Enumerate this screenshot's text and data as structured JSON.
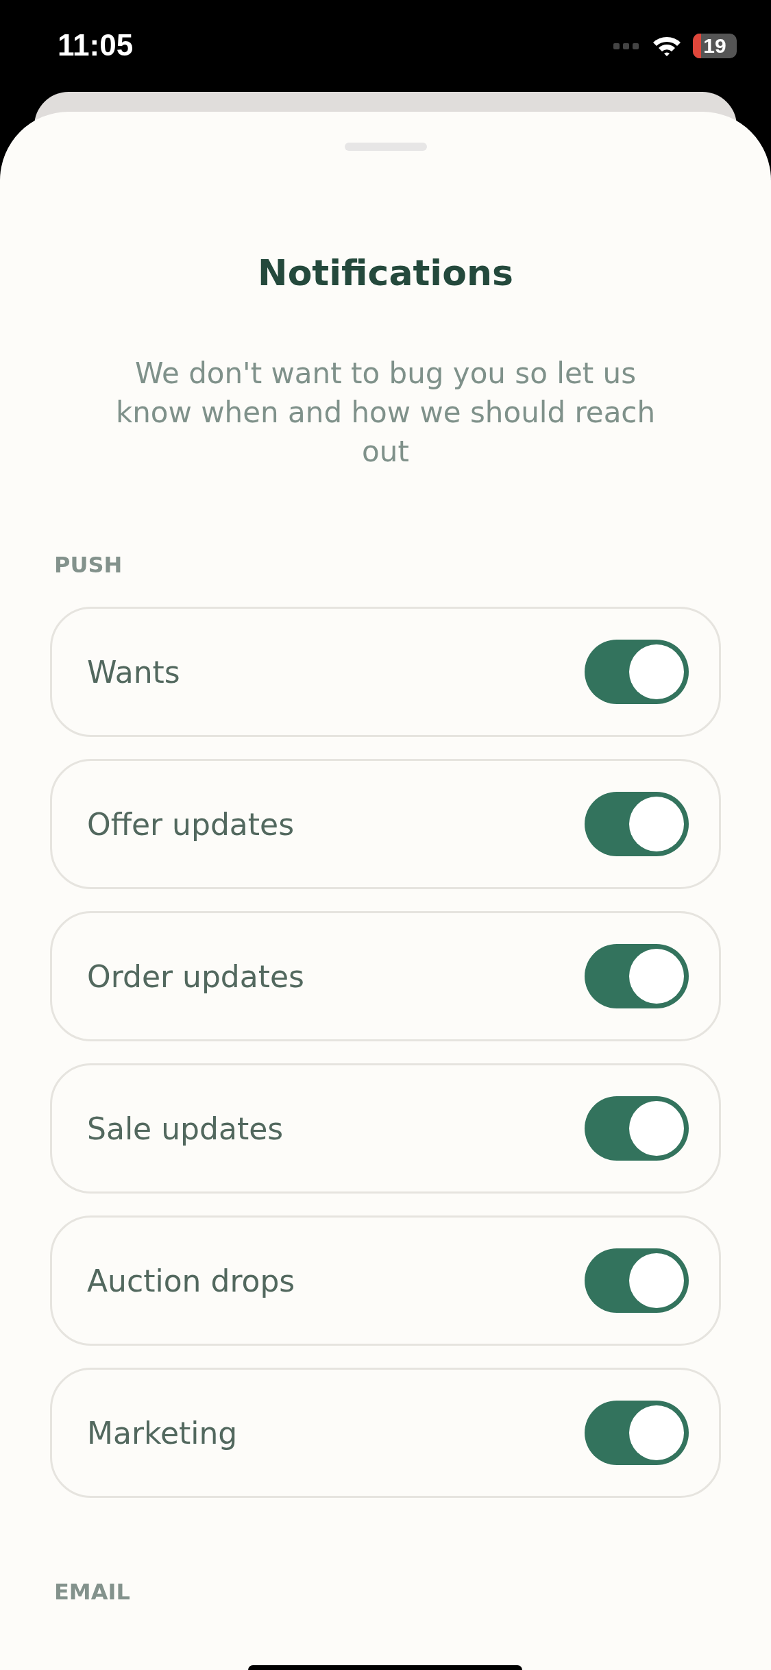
{
  "status_bar": {
    "time": "11:05",
    "battery": "19"
  },
  "title": "Notifications",
  "subtitle": "We don't want to bug you so let us know when and how we should reach out",
  "sections": [
    {
      "heading": "PUSH",
      "items": [
        {
          "label": "Wants",
          "on": true
        },
        {
          "label": "Offer updates",
          "on": true
        },
        {
          "label": "Order updates",
          "on": true
        },
        {
          "label": "Sale updates",
          "on": true
        },
        {
          "label": "Auction drops",
          "on": true
        },
        {
          "label": "Marketing",
          "on": true
        }
      ]
    },
    {
      "heading": "EMAIL"
    }
  ]
}
